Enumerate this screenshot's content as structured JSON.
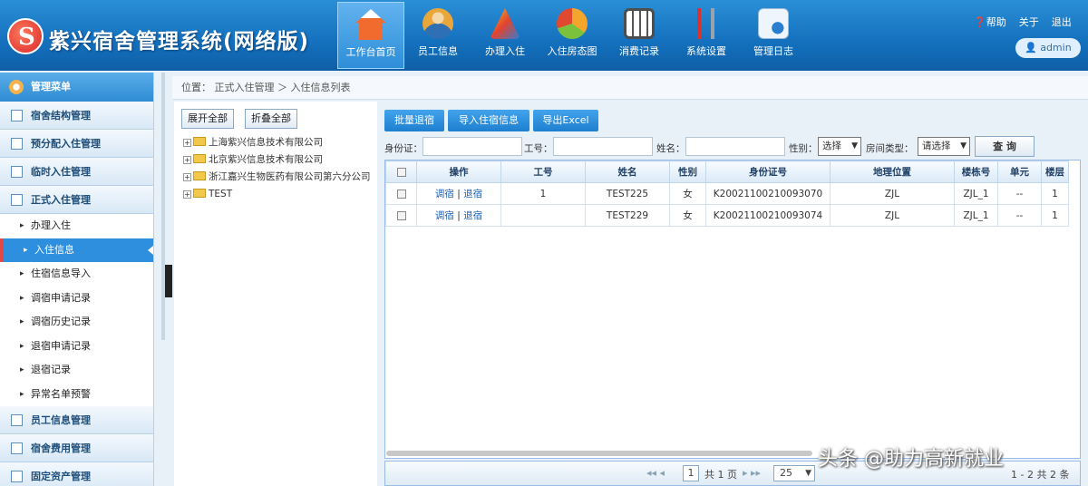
{
  "header": {
    "title": "紫兴宿舍管理系统(网络版)",
    "nav": [
      {
        "label": "工作台首页",
        "icon": "home-icon",
        "color": "#f26b2e"
      },
      {
        "label": "员工信息",
        "icon": "users-icon",
        "color": "#e9a63a"
      },
      {
        "label": "办理入住",
        "icon": "triangle-tools-icon",
        "color": "#f1c12a"
      },
      {
        "label": "入住房态图",
        "icon": "pie-chart-icon",
        "color": "#7cc13c"
      },
      {
        "label": "消费记录",
        "icon": "calculator-icon",
        "color": "#4d4d4d"
      },
      {
        "label": "系统设置",
        "icon": "tools-icon",
        "color": "#d8332e"
      },
      {
        "label": "管理日志",
        "icon": "log-document-icon",
        "color": "#cfe2f5"
      }
    ],
    "links": [
      "帮助",
      "关于",
      "退出"
    ],
    "user": "admin"
  },
  "sidebar": {
    "title": "管理菜单",
    "groups_top": [
      "宿舍结构管理",
      "预分配入住管理",
      "临时入住管理",
      "正式入住管理"
    ],
    "subs": [
      "办理入住",
      "入住信息",
      "住宿信息导入",
      "调宿申请记录",
      "调宿历史记录",
      "退宿申请记录",
      "退宿记录",
      "异常名单预警"
    ],
    "groups_bottom": [
      "员工信息管理",
      "宿舍费用管理",
      "固定资产管理"
    ]
  },
  "breadcrumb": "位置： 正式入住管理 ＞ 入住信息列表",
  "tree": {
    "expand": "展开全部",
    "collapse": "折叠全部",
    "nodes": [
      "上海紫兴信息技术有限公司",
      "北京紫兴信息技术有限公司",
      "浙江嘉兴生物医药有限公司第六分公司",
      "TEST"
    ]
  },
  "toolbar": [
    "批量退宿",
    "导入住宿信息",
    "导出Excel"
  ],
  "search": {
    "labels": [
      "身份证：",
      "工号：",
      "姓名：",
      "性别：",
      "房间类型："
    ],
    "gender": "选择",
    "room_type": "请选择",
    "query": "查 询"
  },
  "table": {
    "headers": [
      "操作",
      "工号",
      "姓名",
      "性别",
      "身份证号",
      "地理位置",
      "楼栋号",
      "单元",
      "楼层"
    ],
    "rows": [
      [
        "调宿",
        "退宿",
        "1",
        "TEST225",
        "女",
        "K20021100210093070",
        "ZJL",
        "ZJL_1",
        "--",
        "1"
      ],
      [
        "调宿",
        "退宿",
        "",
        "TEST229",
        "女",
        "K20021100210093074",
        "ZJL",
        "ZJL_1",
        "--",
        "1"
      ]
    ],
    "sep": "|"
  },
  "pager": {
    "nav_left": "◂◂ ◂",
    "page": "1",
    "total": "共 1 页",
    "nav_right": "▸ ▸▸",
    "page_size": "25",
    "summary": "1 - 2 共 2 条"
  },
  "watermark": "头条 @助力高新就业"
}
